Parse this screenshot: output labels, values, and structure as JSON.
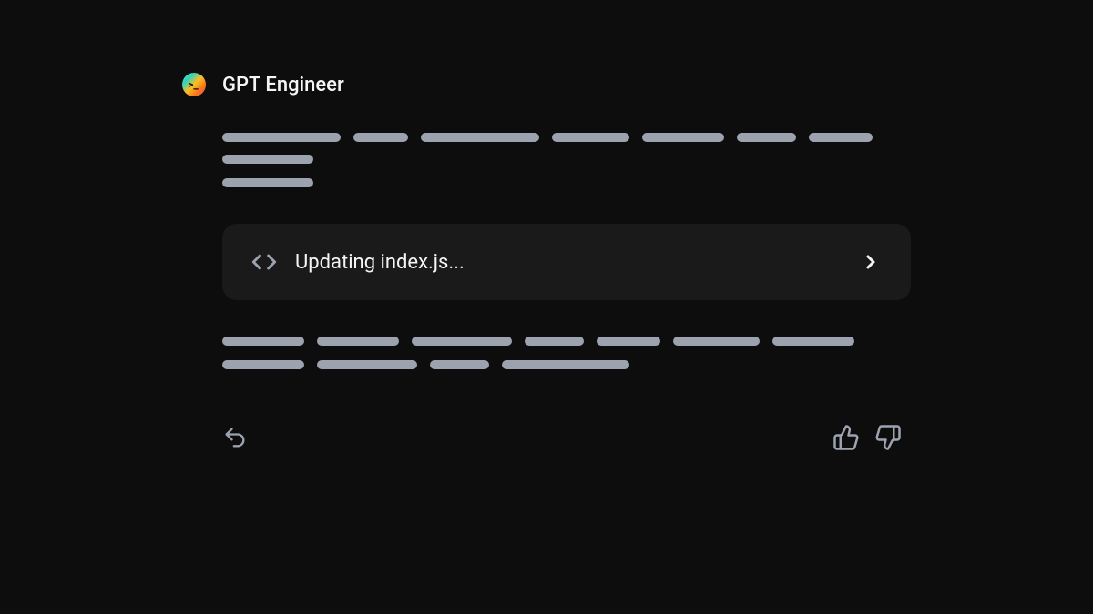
{
  "header": {
    "title": "GPT Engineer",
    "avatar_symbol": ">_"
  },
  "skeleton_top": {
    "row1_widths": [
      130,
      60,
      130,
      85,
      90,
      65,
      70,
      100
    ],
    "row2_widths": [
      100
    ]
  },
  "code_card": {
    "status_text": "Updating index.js..."
  },
  "skeleton_bottom": {
    "row1_widths": [
      90,
      90,
      110,
      65,
      70,
      95,
      90
    ],
    "row2_widths": [
      90,
      110,
      65,
      140
    ]
  },
  "colors": {
    "background": "#0d0d0d",
    "card_bg": "#1a1a1a",
    "text_primary": "#f5f5f5",
    "text_secondary": "#9ca3af",
    "skeleton": "#9ca3af"
  }
}
